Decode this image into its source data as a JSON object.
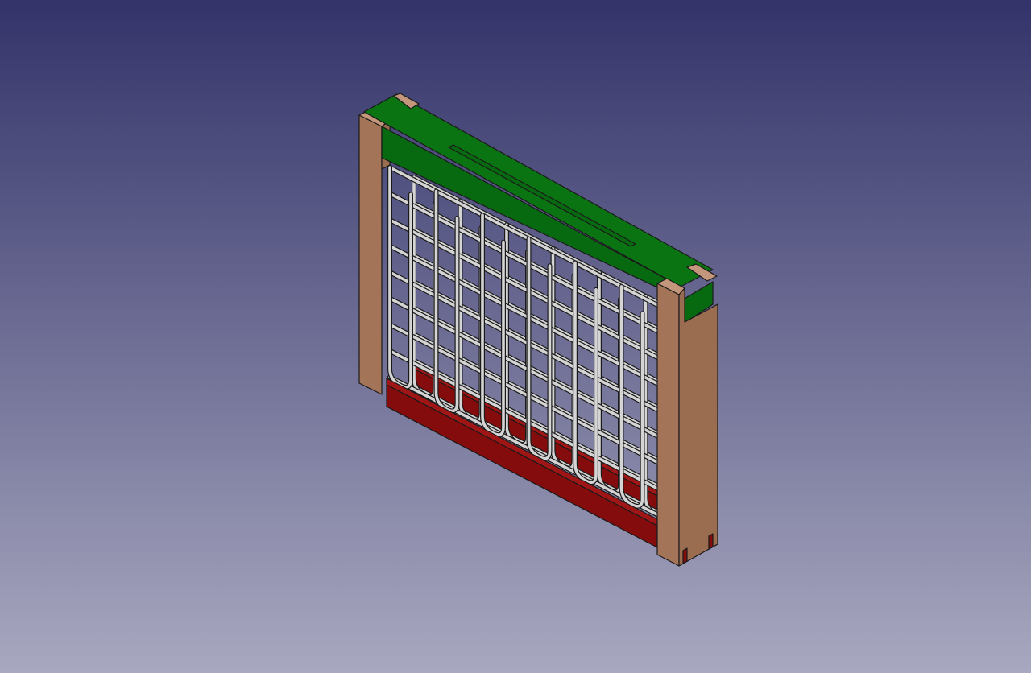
{
  "viewport": {
    "background": {
      "top": "#33336a",
      "bottom": "#a8a8c0"
    }
  },
  "model": {
    "colors": {
      "wood_front": "#a47458",
      "wood_side": "#9a6c50",
      "wood_top": "#c4967c",
      "green_top": "#0b7412",
      "green_front": "#086a10",
      "bar_front": "#840c0c",
      "bar_top": "#a01616",
      "wire": "#d4d4d4",
      "edge": "#1a1a1a"
    },
    "wire_grid": {
      "vertical_wire_count": 6,
      "horizontal_wire_count": 9
    },
    "bottom_bars": 2
  }
}
